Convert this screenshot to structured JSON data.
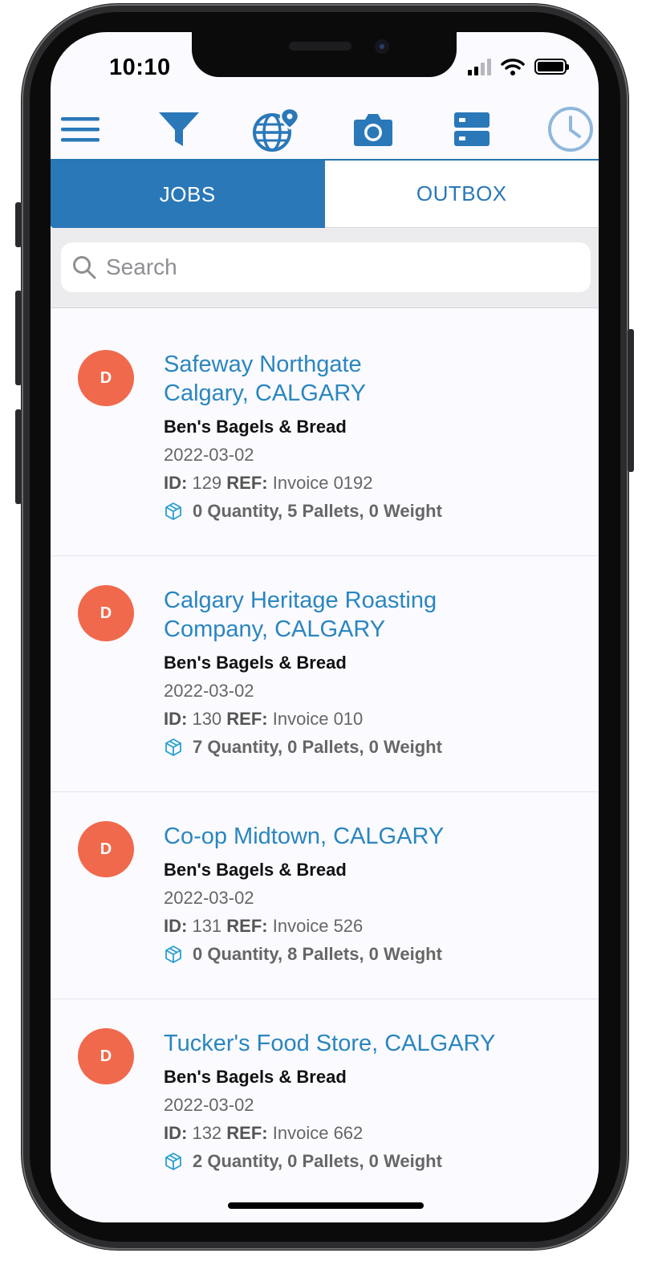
{
  "status": {
    "time": "10:10"
  },
  "tabs": {
    "jobs": "JOBS",
    "outbox": "OUTBOX"
  },
  "search": {
    "placeholder": "Search"
  },
  "jobs": [
    {
      "avatar": "D",
      "title_line1": "Safeway Northgate",
      "title_line2": "Calgary, CALGARY",
      "company": "Ben's Bagels & Bread",
      "date": "2022-03-02",
      "id_label": "ID:",
      "id": "129",
      "ref_label": "REF:",
      "ref": "Invoice 0192",
      "quantities": "0 Quantity, 5 Pallets, 0 Weight"
    },
    {
      "avatar": "D",
      "title_line1": "Calgary Heritage Roasting",
      "title_line2": "Company, CALGARY",
      "company": "Ben's Bagels & Bread",
      "date": "2022-03-02",
      "id_label": "ID:",
      "id": "130",
      "ref_label": "REF:",
      "ref": "Invoice 010",
      "quantities": "7 Quantity, 0 Pallets, 0 Weight"
    },
    {
      "avatar": "D",
      "title_line1": "Co-op Midtown, CALGARY",
      "company": "Ben's Bagels & Bread",
      "date": "2022-03-02",
      "id_label": "ID:",
      "id": "131",
      "ref_label": "REF:",
      "ref": "Invoice 526",
      "quantities": "0 Quantity, 8 Pallets, 0 Weight"
    },
    {
      "avatar": "D",
      "title_line1": "Tucker's Food Store, CALGARY",
      "company": "Ben's Bagels & Bread",
      "date": "2022-03-02",
      "id_label": "ID:",
      "id": "132",
      "ref_label": "REF:",
      "ref": "Invoice 662",
      "quantities": "2 Quantity, 0 Pallets, 0 Weight"
    }
  ],
  "colors": {
    "accent": "#2a78b8",
    "title": "#2a86bf",
    "avatar": "#f0694c"
  },
  "icons": [
    "menu-icon",
    "filter-icon",
    "globe-location-icon",
    "camera-icon",
    "server-icon",
    "clock-icon",
    "search-icon",
    "package-icon"
  ]
}
